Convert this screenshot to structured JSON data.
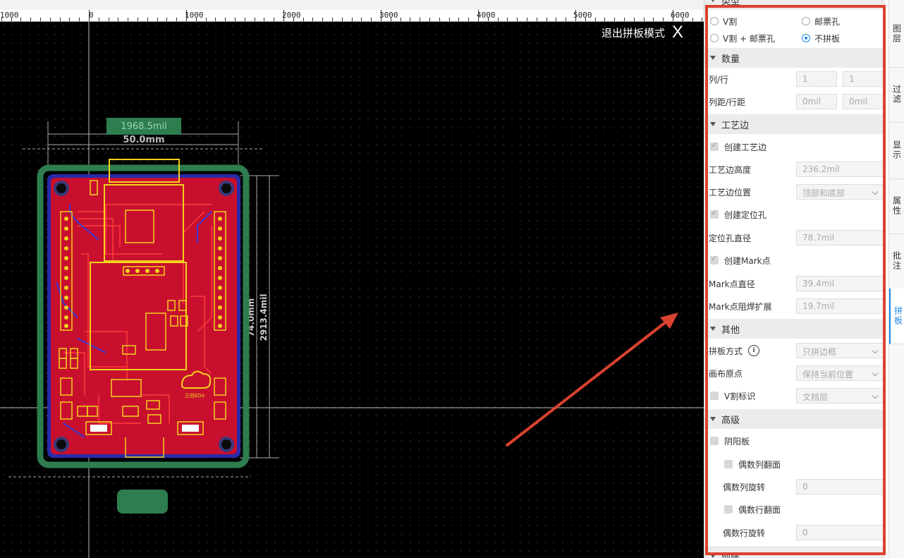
{
  "ruler": {
    "labels": [
      "1000",
      "0",
      "1000",
      "2000",
      "3000",
      "4000",
      "5000",
      "6000"
    ]
  },
  "canvas": {
    "exit_label": "退出拼板模式",
    "exit_icon": "X",
    "dim_width_mil": "1968.5mil",
    "dim_width_mm": "50.0mm",
    "dim_height_mil": "2913.4mil",
    "dim_height_mm": "74.0mm",
    "pcb_colors": {
      "panel_rail": "#2e7d4f",
      "board": "#c8102e",
      "silk": "#f2d21b",
      "trace": "#ff2a2a",
      "copper_bottom": "#2a2aa8"
    }
  },
  "panel": {
    "top_partial": "类型",
    "type_options": [
      "V割",
      "邮票孔",
      "V割 + 邮票孔",
      "不拼板"
    ],
    "type_selected": "不拼板",
    "sections": {
      "quantity": "数量",
      "rail": "工艺边",
      "other": "其他",
      "advanced": "高级",
      "bottom_partial": "创建"
    },
    "quantity": {
      "cols_rows_label": "列/行",
      "cols_value": "1",
      "rows_value": "1",
      "spacing_label": "列距/行距",
      "col_spacing": "0mil",
      "row_spacing": "0mil"
    },
    "rail": {
      "create_rail_label": "创建工艺边",
      "create_rail_checked": true,
      "rail_height_label": "工艺边高度",
      "rail_height_value": "236.2mil",
      "rail_position_label": "工艺边位置",
      "rail_position_value": "顶部和底部",
      "create_hole_label": "创建定位孔",
      "create_hole_checked": true,
      "hole_diameter_label": "定位孔直径",
      "hole_diameter_value": "78.7mil",
      "create_mark_label": "创建Mark点",
      "create_mark_checked": true,
      "mark_diameter_label": "Mark点直径",
      "mark_diameter_value": "39.4mil",
      "mark_mask_label": "Mark点阻焊扩展",
      "mark_mask_value": "19.7mil"
    },
    "other": {
      "panel_method_label": "拼板方式",
      "panel_method_value": "只拼边框",
      "origin_label": "画布原点",
      "origin_value": "保持当前位置",
      "vcut_mark_label": "V割标识",
      "vcut_mark_value": "文档层"
    },
    "advanced": {
      "yinyang_label": "阴阳板",
      "even_col_flip_label": "偶数列翻面",
      "even_col_rotate_label": "偶数列旋转",
      "even_col_rotate_value": "0",
      "even_row_flip_label": "偶数行翻面",
      "even_row_rotate_label": "偶数行旋转",
      "even_row_rotate_value": "0"
    }
  },
  "tabs": [
    {
      "label": "图层",
      "active": false
    },
    {
      "label": "过滤",
      "active": false
    },
    {
      "label": "显示",
      "active": false
    },
    {
      "label": "属性",
      "active": false
    },
    {
      "label": "批注",
      "active": false
    },
    {
      "label": "拼板",
      "active": true
    }
  ]
}
